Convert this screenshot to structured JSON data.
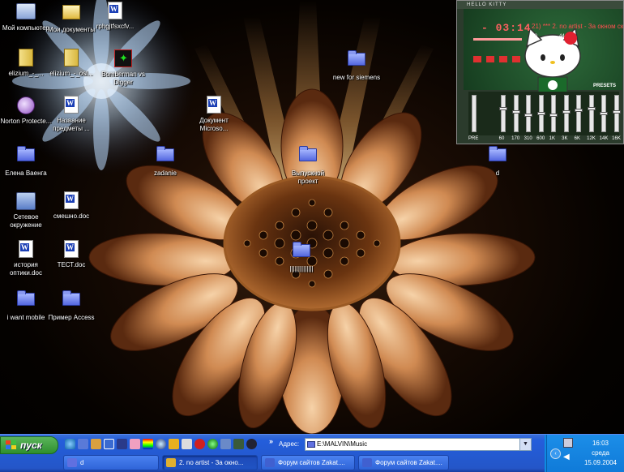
{
  "desktop": {
    "icons": [
      {
        "name": "my-computer-icon",
        "label": "Мой компьютер",
        "kind": "pc"
      },
      {
        "name": "my-documents-icon",
        "label": "Мои документы",
        "kind": "mydocs"
      },
      {
        "name": "rphgjtfsxcfv-doc-icon",
        "label": "rphgjtfsxcfv...",
        "kind": "doc"
      },
      {
        "name": "elizium-archive-1-icon",
        "label": "elizium_-_...",
        "kind": "zip"
      },
      {
        "name": "elizium-archive-2-icon",
        "label": "elizium_-_osl...",
        "kind": "zip"
      },
      {
        "name": "bomberman-digger-icon",
        "label": "Bomberman vs Digger",
        "kind": "game"
      },
      {
        "name": "new-for-siemens-folder-icon",
        "label": "new for siemens",
        "kind": "folder"
      },
      {
        "name": "norton-protected-icon",
        "label": "Norton Protecte...",
        "kind": "norton"
      },
      {
        "name": "nazvanie-predmety-doc-icon",
        "label": "Название предметы ...",
        "kind": "doc"
      },
      {
        "name": "dokument-microsoft-icon",
        "label": "Документ Microso...",
        "kind": "doc"
      },
      {
        "name": "elena-vaenga-folder-icon",
        "label": "Елена Ваенга",
        "kind": "folder"
      },
      {
        "name": "zadanie-folder-icon",
        "label": "zadanie",
        "kind": "folder"
      },
      {
        "name": "vypusknoy-proekt-folder-icon",
        "label": "Выпускной проект",
        "kind": "folder"
      },
      {
        "name": "d-folder-icon",
        "label": "d",
        "kind": "folder"
      },
      {
        "name": "network-neighborhood-icon",
        "label": "Сетевое окружение",
        "kind": "net"
      },
      {
        "name": "smeshno-doc-icon",
        "label": "смешно.doc",
        "kind": "doc"
      },
      {
        "name": "center-folder-icon",
        "label": "||||||||||||||",
        "kind": "folder"
      },
      {
        "name": "istoriya-optiki-doc-icon",
        "label": "история оптики.doc",
        "kind": "doc"
      },
      {
        "name": "test-doc-icon",
        "label": "ТЕСТ.doc",
        "kind": "doc"
      },
      {
        "name": "i-want-mobile-folder-icon",
        "label": "i want mobile",
        "kind": "folder"
      },
      {
        "name": "primer-access-folder-icon",
        "label": "Пример Access",
        "kind": "folder"
      }
    ]
  },
  "winamp": {
    "title": "HELLO KITTY",
    "time": "- 03:14",
    "marquee": "21) *** 2. no artist - За окном ск",
    "bitrate": "120",
    "khz": "44",
    "presets_label": "PRESETS",
    "pre_label": "PRE",
    "eq_bands": [
      "60",
      "170",
      "310",
      "600",
      "1K",
      "3K",
      "6K",
      "12K",
      "14K",
      "16K"
    ],
    "eq_levels": [
      0.35,
      0.45,
      0.55,
      0.5,
      0.55,
      0.45,
      0.4,
      0.35,
      0.5,
      0.45
    ]
  },
  "taskbar": {
    "start_label": "пуск",
    "address_label": "Адрес:",
    "address_value": "E:\\MALVIN\\Music",
    "chevron": "»",
    "tasks": [
      {
        "label": "d",
        "active": false,
        "color": "#6070e0"
      },
      {
        "label": "2. no artist - За окно...",
        "active": true,
        "color": "#e0b030"
      },
      {
        "label": "Форум сайтов Zakat....",
        "active": false,
        "color": "#4060d0"
      },
      {
        "label": "Форум сайтов Zakat....",
        "active": false,
        "color": "#4060d0"
      }
    ],
    "clock_time": "16:03",
    "clock_day": "среда",
    "clock_date": "15.09.2004"
  },
  "colors": {
    "taskbar_blue": "#245edb",
    "start_green": "#3c9a3c",
    "tray_blue": "#0f7ad8",
    "winamp_bg": "#2b3b2c",
    "winamp_red": "#ff5050"
  }
}
